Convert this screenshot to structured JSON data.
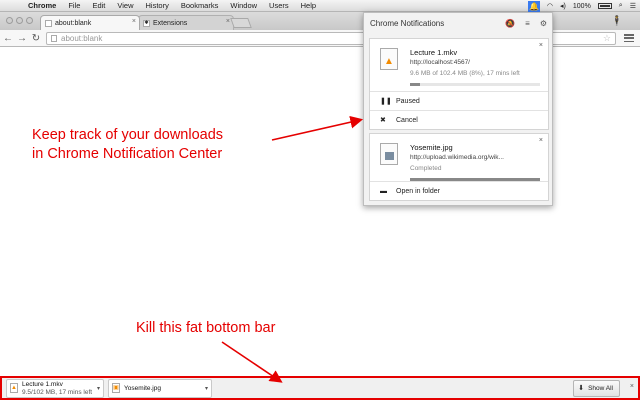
{
  "menubar": {
    "items": [
      "Chrome",
      "File",
      "Edit",
      "View",
      "History",
      "Bookmarks",
      "Window",
      "Users",
      "Help"
    ],
    "battery": "100%"
  },
  "tabs": [
    {
      "title": "about:blank",
      "active": true
    },
    {
      "title": "Extensions",
      "active": false
    }
  ],
  "toolbar": {
    "url": "about:blank"
  },
  "notification_center": {
    "title": "Chrome Notifications",
    "items": [
      {
        "title": "Lecture 1.mkv",
        "url": "http://localhost:4567/",
        "status": "9.6 MB of 102.4 MB (8%), 17 mins left",
        "progress_fraction": 0.08,
        "actions": [
          "Paused",
          "Cancel"
        ]
      },
      {
        "title": "Yosemite.jpg",
        "url": "http://upload.wikimedia.org/wik...",
        "status": "Completed",
        "progress_fraction": 1.0,
        "actions": [
          "Open in folder"
        ]
      }
    ]
  },
  "annotations": {
    "top_line1": "Keep track of your downloads",
    "top_line2": "in Chrome Notification Center",
    "bottom": "Kill this fat bottom bar",
    "color": "#e50000"
  },
  "download_shelf": {
    "items": [
      {
        "name": "Lecture 1.mkv",
        "status": "9.5/102 MB, 17 mins left"
      },
      {
        "name": "Yosemite.jpg",
        "status": ""
      }
    ],
    "show_all": "Show All"
  }
}
